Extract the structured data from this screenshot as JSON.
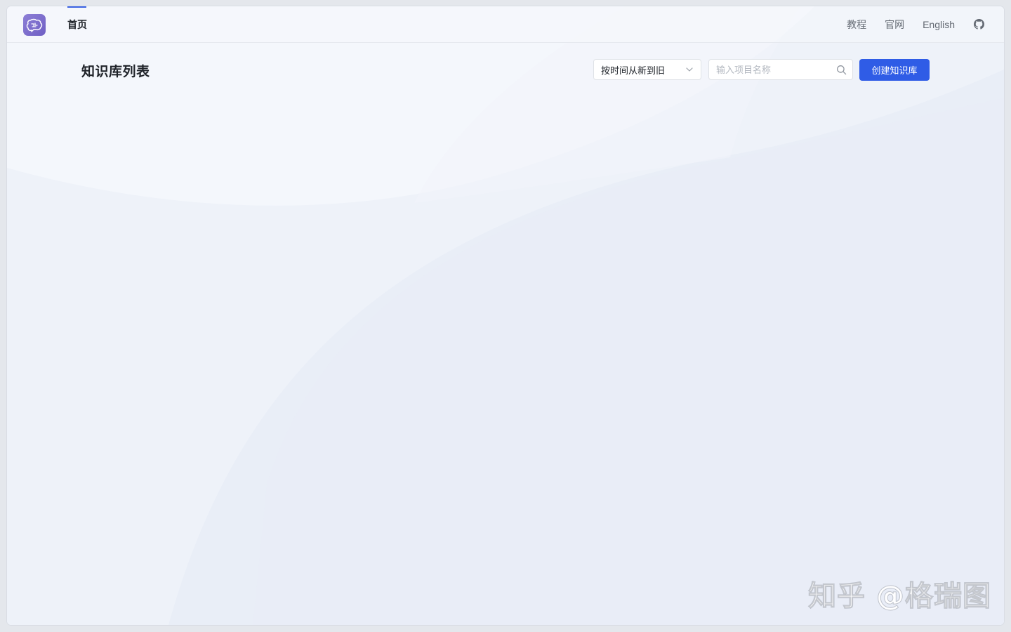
{
  "nav": {
    "home_label": "首页",
    "right_links": [
      "教程",
      "官网",
      "English"
    ]
  },
  "icons": {
    "logo": "brain-chat-logo-icon",
    "github": "github-icon",
    "search": "search-icon",
    "chevron": "chevron-down-icon"
  },
  "page": {
    "title": "知识库列表"
  },
  "sort": {
    "selected": "按时间从新到旧"
  },
  "search": {
    "placeholder": "输入项目名称",
    "value": ""
  },
  "actions": {
    "create_label": "创建知识库"
  },
  "watermark": {
    "text": "知乎 @格瑞图"
  },
  "colors": {
    "accent": "#2f5ce6",
    "logo": "#7b6ccd",
    "background": "#f3f6fb"
  }
}
